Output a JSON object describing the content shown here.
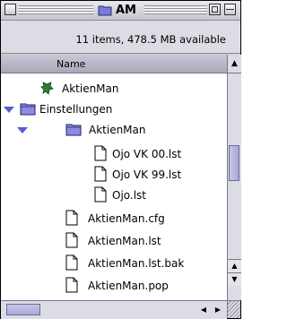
{
  "window": {
    "title": "AM",
    "info": "11 items, 478.5 MB available",
    "column_header": "Name"
  },
  "items": [
    {
      "label": "AktienMan",
      "icon": "app-icon"
    },
    {
      "label": "Einstellungen",
      "icon": "folder-icon",
      "expanded": true
    },
    {
      "label": "AktienMan",
      "icon": "folder-icon",
      "expanded": true
    },
    {
      "label": "Ojo VK 00.lst",
      "icon": "document-icon"
    },
    {
      "label": "Ojo VK 99.lst",
      "icon": "document-icon"
    },
    {
      "label": "Ojo.lst",
      "icon": "document-icon"
    },
    {
      "label": "AktienMan.cfg",
      "icon": "document-icon"
    },
    {
      "label": "AktienMan.lst",
      "icon": "document-icon"
    },
    {
      "label": "AktienMan.lst.bak",
      "icon": "document-icon"
    },
    {
      "label": "AktienMan.pop",
      "icon": "document-icon"
    }
  ]
}
